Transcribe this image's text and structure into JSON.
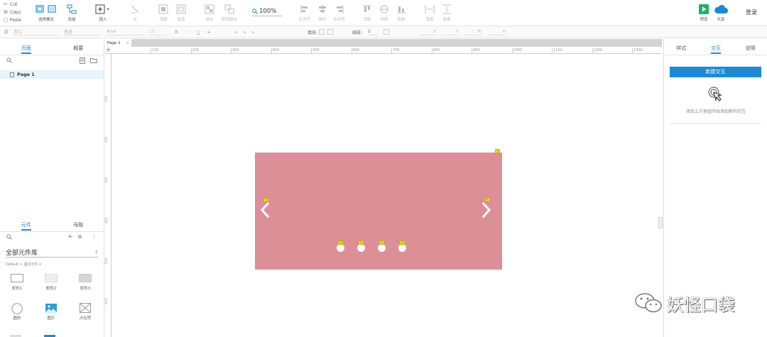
{
  "clipboard": {
    "cut": "Cut",
    "copy": "Copy",
    "paste": "Paste"
  },
  "toolbar": {
    "select_mode": "选择模式",
    "connect": "连接",
    "insert": "插入",
    "point": "点",
    "top": "顶层",
    "bottom": "底层",
    "group": "组合",
    "ungroup": "取消组合",
    "zoom": "100%",
    "align": "左对齐",
    "center": "居中",
    "right": "右对齐",
    "top_align": "顶部",
    "middle": "中部",
    "bottom_align": "底部",
    "width": "宽度",
    "height": "高度",
    "preview": "预览",
    "share": "共享",
    "login": "登录"
  },
  "formatbar": {
    "style": "默认",
    "text_style": "普通",
    "font": "Arial",
    "size": "13",
    "fill": "填充:",
    "line": "线段:",
    "line_width": "1",
    "x_label": "X",
    "y_label": "Y",
    "w_label": "W",
    "h_label": "H"
  },
  "left_panel": {
    "pages_tab": "页面",
    "outline_tab": "概要",
    "page_item": "Page 1",
    "widgets_tab": "元件",
    "masters_tab": "母版",
    "library_title": "全部元件库",
    "breadcrumb": "Default > 基本元件 ▾",
    "widgets": [
      "矩形1",
      "矩形2",
      "矩形3",
      "圆形",
      "图片",
      "占位符"
    ]
  },
  "canvas": {
    "tab_label": "Page 1",
    "ruler_x": [
      "100",
      "200",
      "300",
      "400",
      "500",
      "600",
      "700",
      "800",
      "900",
      "1000",
      "1100",
      "1200",
      "1300"
    ],
    "ruler_y": [
      "100",
      "200",
      "300",
      "400",
      "500",
      "600"
    ],
    "badge_label": "5"
  },
  "right_panel": {
    "style_tab": "样式",
    "interaction_tab": "交互",
    "notes_tab": "说明",
    "new_interaction": "新建交互",
    "hint": "添加上方按钮开始添加新的交互"
  },
  "watermark": {
    "text": "妖怪口袋"
  },
  "colors": {
    "accent": "#1a8ad6",
    "slider_bg": "#dd8f98",
    "preview_green": "#19b36b",
    "share_blue": "#1a8ad6",
    "badge": "#fff200"
  }
}
